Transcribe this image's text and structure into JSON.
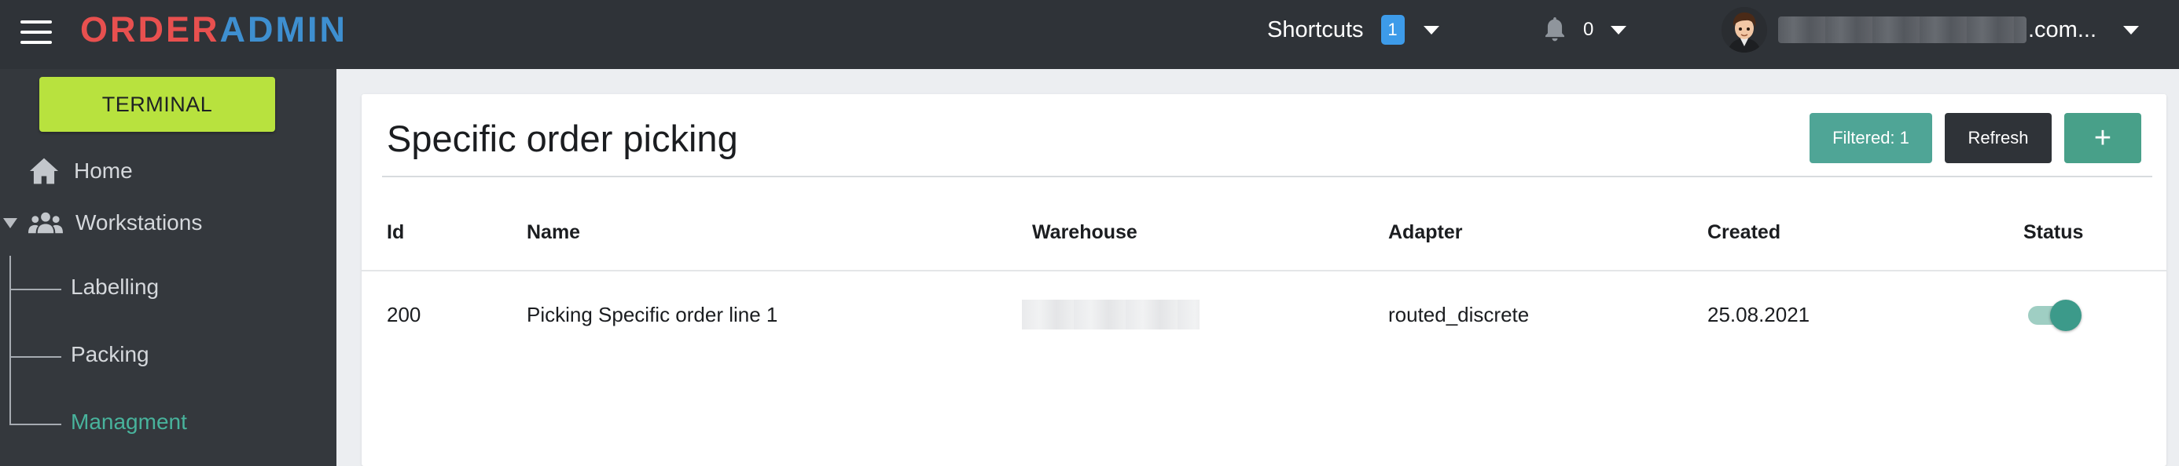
{
  "header": {
    "logo_part1": "ORDER",
    "logo_part2": "ADMIN",
    "shortcuts_label": "Shortcuts",
    "shortcuts_count": "1",
    "notifications_count": "0",
    "user_email_suffix": ".com..."
  },
  "sidebar": {
    "terminal_label": "TERMINAL",
    "home_label": "Home",
    "workstations_label": "Workstations",
    "sub_items": [
      "Labelling",
      "Packing",
      "Managment"
    ],
    "active_item": "Managment"
  },
  "page": {
    "title": "Specific order picking",
    "filter_button": "Filtered: 1",
    "refresh_button": "Refresh",
    "add_button": "+"
  },
  "table": {
    "columns": [
      "Id",
      "Name",
      "Warehouse",
      "Adapter",
      "Created",
      "Status"
    ],
    "rows": [
      {
        "id": "200",
        "name": "Picking Specific order line 1",
        "warehouse": "",
        "adapter": "routed_discrete",
        "created": "25.08.2021",
        "status_enabled": true
      }
    ]
  },
  "colors": {
    "topbar": "#2f3338",
    "sidebar": "#34383d",
    "terminal": "#b8e23e",
    "logo_red": "#e8504f",
    "logo_blue": "#3e8fd0",
    "accent_teal": "#4fa596",
    "badge_blue": "#3d9be9"
  },
  "icons": [
    "menu-icon",
    "bell-icon",
    "home-icon",
    "workstations-icon",
    "caret-down-icon",
    "avatar"
  ]
}
